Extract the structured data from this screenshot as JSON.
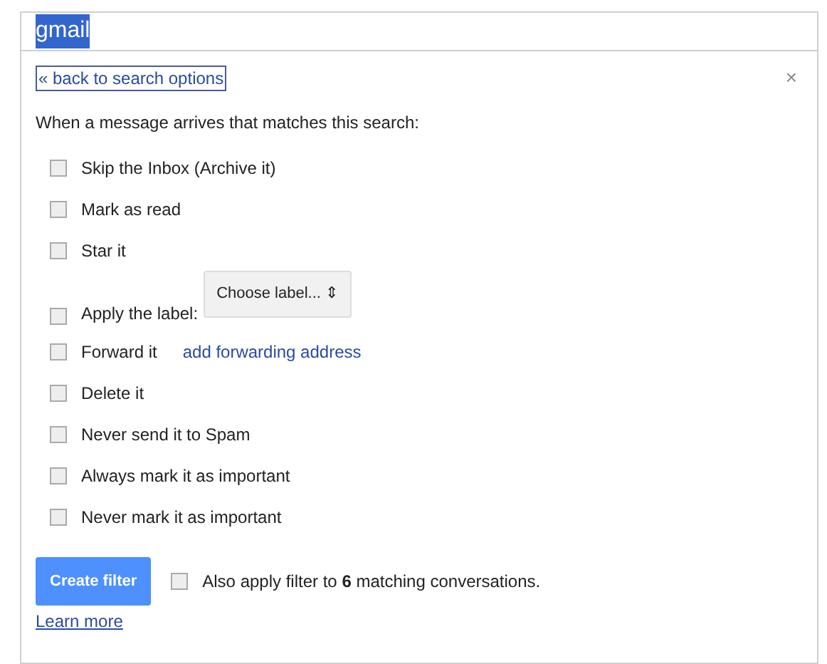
{
  "search": {
    "value": "gmail",
    "selected_text": true
  },
  "back_link": "« back to search options",
  "close": "×",
  "heading": "When a message arrives that matches this search:",
  "options": [
    {
      "kind": "plain",
      "label": "Skip the Inbox (Archive it)",
      "checked": false
    },
    {
      "kind": "plain",
      "label": "Mark as read",
      "checked": false
    },
    {
      "kind": "plain",
      "label": "Star it",
      "checked": false
    },
    {
      "kind": "label",
      "label": "Apply the label:",
      "checked": false,
      "select": "Choose label... ⇕"
    },
    {
      "kind": "forward",
      "label": "Forward it",
      "checked": false,
      "link": "add forwarding address"
    },
    {
      "kind": "plain",
      "label": "Delete it",
      "checked": false
    },
    {
      "kind": "plain",
      "label": "Never send it to Spam",
      "checked": false
    },
    {
      "kind": "plain",
      "label": "Always mark it as important",
      "checked": false
    },
    {
      "kind": "plain",
      "label": "Never mark it as important",
      "checked": false
    }
  ],
  "create_button": "Create filter",
  "also_apply": {
    "text": "Also apply filter to **6** matching conversations.",
    "checked": false
  },
  "learn_more": "Learn more"
}
